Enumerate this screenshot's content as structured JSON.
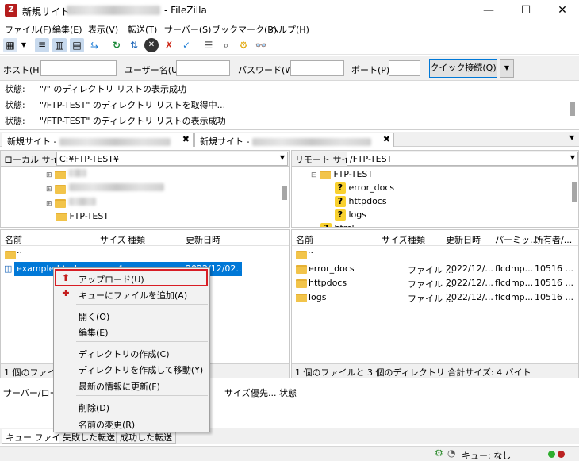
{
  "window": {
    "title_prefix": "新規サイト - ",
    "title_suffix": "- FileZilla",
    "min": "—",
    "max": "☐",
    "close": "✕"
  },
  "menu": [
    "ファイル(F)",
    "編集(E)",
    "表示(V)",
    "転送(T)",
    "サーバー(S)",
    "ブックマーク(B)",
    "ヘルプ(H)"
  ],
  "quickconnect": {
    "host": "ホスト(H):",
    "user": "ユーザー名(U):",
    "password": "パスワード(W):",
    "port": "ポート(P):",
    "button": "クイック接続(Q)",
    "drop": "▼"
  },
  "log": [
    {
      "k": "状態:",
      "v": "\"/\" のディレクトリ リストの表示成功"
    },
    {
      "k": "状態:",
      "v": "\"/FTP-TEST\" のディレクトリ リストを取得中..."
    },
    {
      "k": "状態:",
      "v": "\"/FTP-TEST\" のディレクトリ リストの表示成功"
    }
  ],
  "tabs": [
    {
      "label": "新規サイト - "
    },
    {
      "label": "新規サイト - "
    }
  ],
  "tab_close": "✖",
  "local": {
    "site_label": "ローカル サイト:",
    "path": "C:¥FTP-TEST¥",
    "tree": [
      "FTP-TEST"
    ],
    "headers": {
      "name": "名前",
      "size": "サイズ",
      "type": "種類",
      "modified": "更新日時"
    },
    "rows": [
      {
        "name": ".."
      },
      {
        "name": "example.html",
        "size": "4",
        "type": "HTML ソース",
        "modified": "2022/12/02..."
      }
    ],
    "status": "1 個のファイル:"
  },
  "remote": {
    "site_label": "リモート サイト:",
    "path": "/FTP-TEST",
    "tree": {
      "root": "FTP-TEST",
      "children": [
        "error_docs",
        "httpdocs",
        "logs"
      ],
      "cut": "html"
    },
    "headers": {
      "name": "名前",
      "size": "サイズ",
      "type": "種類",
      "modified": "更新日時",
      "perm": "パーミッ...",
      "owner": "所有者/..."
    },
    "rows": [
      {
        "name": ".."
      },
      {
        "name": "error_docs",
        "type": "ファイル ...",
        "modified": "2022/12/...",
        "perm": "flcdmp...",
        "owner": "10516 ..."
      },
      {
        "name": "httpdocs",
        "type": "ファイル ...",
        "modified": "2022/12/...",
        "perm": "flcdmp...",
        "owner": "10516 ..."
      },
      {
        "name": "logs",
        "type": "ファイル ...",
        "modified": "2022/12/...",
        "perm": "flcdmp...",
        "owner": "10516 ..."
      }
    ],
    "status": "1 個のファイルと 3 個のディレクトリ 合計サイズ: 4 バイト"
  },
  "queue": {
    "headers": {
      "server": "サーバー/ローカ",
      "size": "サイズ",
      "priority": "優先...",
      "state": "状態"
    },
    "tabs": [
      "キュー ファイル",
      "失敗した転送",
      "成功した転送"
    ]
  },
  "statusbar": {
    "queue": "キュー: なし"
  },
  "context_menu": [
    {
      "label": "アップロード(U)",
      "icon": "upload-icon",
      "highlighted": true
    },
    {
      "label": "キューにファイルを追加(A)",
      "icon": "add-queue-icon"
    },
    {
      "label": "開く(O)"
    },
    {
      "label": "編集(E)"
    },
    {
      "label": "ディレクトリの作成(C)"
    },
    {
      "label": "ディレクトリを作成して移動(Y)"
    },
    {
      "label": "最新の情報に更新(F)"
    },
    {
      "label": "削除(D)"
    },
    {
      "label": "名前の変更(R)"
    }
  ],
  "colors": {
    "selection": "#0078d7",
    "highlight_border": "#d81d24",
    "folder": "#f2c44a"
  }
}
